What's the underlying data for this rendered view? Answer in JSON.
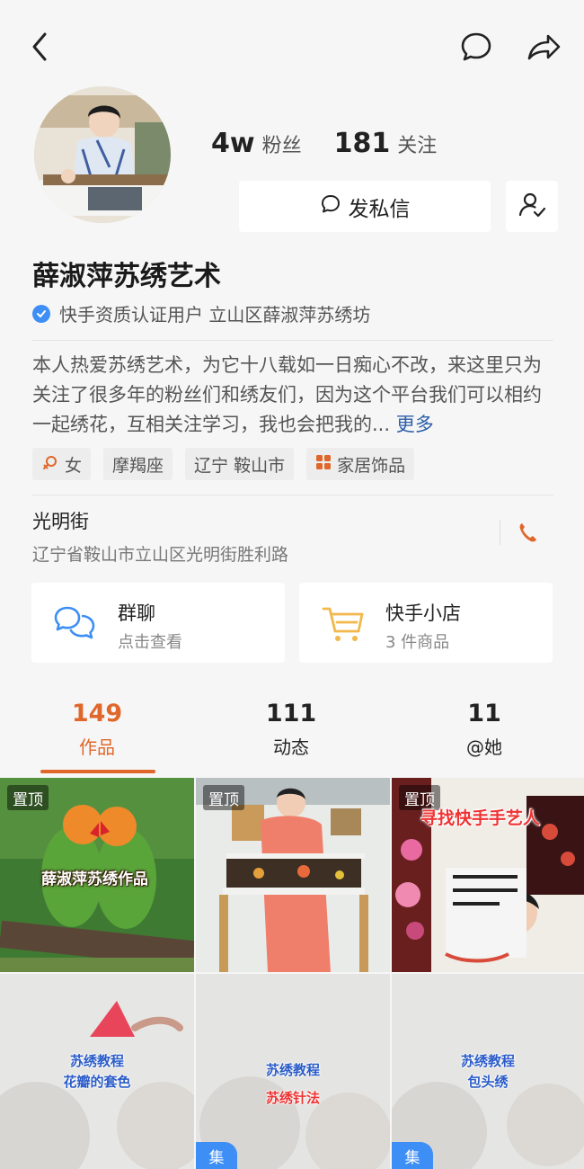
{
  "header": {
    "back_icon": "back-arrow-icon",
    "message_icon": "chat-bubble-icon",
    "share_icon": "share-icon"
  },
  "stats": {
    "fans_count": "4w",
    "fans_label": "粉丝",
    "following_count": "181",
    "following_label": "关注"
  },
  "actions": {
    "dm_label": "发私信"
  },
  "profile": {
    "name": "薛淑萍苏绣艺术",
    "verification": "快手资质认证用户 立山区薛淑萍苏绣坊",
    "bio": "本人热爱苏绣艺术，为它十八载如一日痴心不改，来这里只为关注了很多年的粉丝们和绣友们，因为这个平台我们可以相约一起绣花，互相关注学习，我也会把我的...",
    "bio_more": "更多"
  },
  "tags": [
    {
      "label": "女"
    },
    {
      "label": "摩羯座"
    },
    {
      "label": "辽宁 鞍山市"
    },
    {
      "label": "家居饰品"
    }
  ],
  "location": {
    "name": "光明街",
    "address": "辽宁省鞍山市立山区光明街胜利路"
  },
  "cards": {
    "group_chat": {
      "title": "群聊",
      "subtitle": "点击查看"
    },
    "shop": {
      "title": "快手小店",
      "subtitle": "3 件商品"
    }
  },
  "tabs": [
    {
      "count": "149",
      "label": "作品"
    },
    {
      "count": "111",
      "label": "动态"
    },
    {
      "count": "11",
      "label": "@她"
    }
  ],
  "grid": {
    "pinned_label": "置顶",
    "tile1_caption": "薛淑萍苏绣作品",
    "tile3_caption": "寻找快手手艺人",
    "tile4_line1": "苏绣教程",
    "tile4_line2": "花瓣的套色",
    "tile5_line1": "苏绣教程",
    "tile5_line2": "苏绣针法",
    "tile6_line1": "苏绣教程",
    "tile6_line2": "包头绣",
    "collection_label": "集"
  },
  "colors": {
    "accent": "#e0672b",
    "link": "#2c5fa8",
    "verify": "#3d8ff5",
    "shop_cart": "#f2b84b",
    "chat_icon": "#3d8ff5"
  }
}
